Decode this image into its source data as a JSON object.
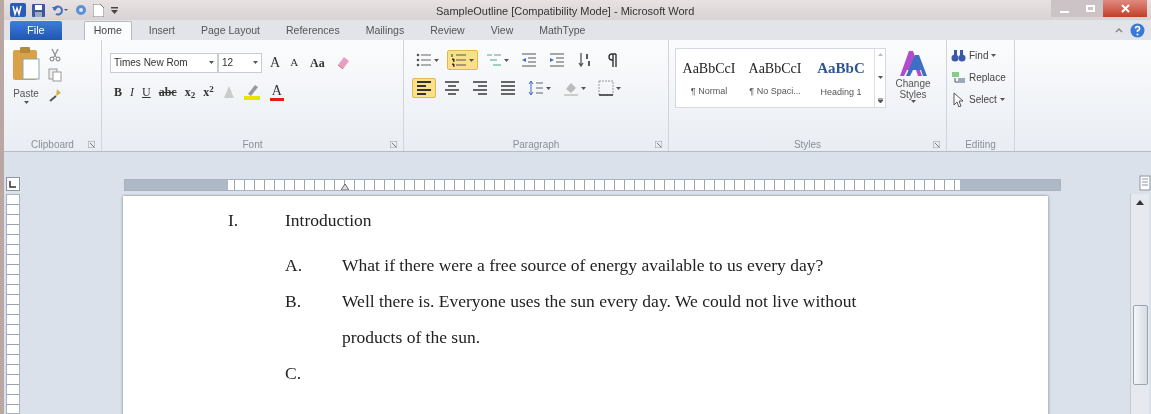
{
  "window": {
    "title": "SampleOutline [Compatibility Mode]  -  Microsoft Word"
  },
  "tabs": [
    {
      "label": "File",
      "kind": "file",
      "selected": false
    },
    {
      "label": "Home",
      "kind": "tab",
      "selected": true
    },
    {
      "label": "Insert",
      "kind": "tab",
      "selected": false
    },
    {
      "label": "Page Layout",
      "kind": "tab",
      "selected": false
    },
    {
      "label": "References",
      "kind": "tab",
      "selected": false
    },
    {
      "label": "Mailings",
      "kind": "tab",
      "selected": false
    },
    {
      "label": "Review",
      "kind": "tab",
      "selected": false
    },
    {
      "label": "View",
      "kind": "tab",
      "selected": false
    },
    {
      "label": "MathType",
      "kind": "tab",
      "selected": false
    }
  ],
  "clipboard": {
    "label": "Clipboard",
    "paste": "Paste"
  },
  "font": {
    "label": "Font",
    "font_name": "Times New Rom",
    "font_size": "12",
    "grow": "A",
    "shrink": "A",
    "change_case": "Aa",
    "format_buttons": [
      {
        "label": "B",
        "kind": "bold"
      },
      {
        "label": "I",
        "kind": "italic"
      },
      {
        "label": "U",
        "kind": "underline"
      },
      {
        "label": "abc",
        "kind": "strike"
      },
      {
        "label": "x$_{2}$",
        "kind": "plain"
      },
      {
        "label": "x$^{2}$",
        "kind": "plain"
      }
    ],
    "font_color": "A"
  },
  "paragraph": {
    "label": "Paragraph",
    "row_1": [
      {
        "kind": "bullets",
        "on": false
      },
      {
        "kind": "numbering",
        "on": true
      },
      {
        "kind": "multilevel",
        "on": false
      },
      {
        "kind": "outdent",
        "on": false
      },
      {
        "kind": "indent",
        "on": false
      },
      {
        "kind": "sort",
        "on": false
      },
      {
        "kind": "pilcrow",
        "on": false
      }
    ],
    "row_2": [
      {
        "kind": "align-left",
        "on": true
      },
      {
        "kind": "align-center",
        "on": false
      },
      {
        "kind": "align-right",
        "on": false
      },
      {
        "kind": "justify",
        "on": false
      },
      {
        "kind": "line-spacing",
        "on": false
      },
      {
        "kind": "shading",
        "on": false
      },
      {
        "kind": "borders",
        "on": false
      }
    ]
  },
  "styles": {
    "label": "Styles",
    "items": [
      {
        "preview": "AaBbCcI",
        "name": "¶ Normal",
        "kind": "body"
      },
      {
        "preview": "AaBbCcI",
        "name": "¶ No Spaci...",
        "kind": "body"
      },
      {
        "preview": "AaBbC",
        "name": "Heading 1",
        "kind": "heading"
      }
    ],
    "change_styles": "Change Styles"
  },
  "editing": {
    "label": "Editing",
    "items": [
      {
        "label": "Find",
        "kind": "find",
        "dropdown": true
      },
      {
        "label": "Replace",
        "kind": "replace",
        "dropdown": false
      },
      {
        "label": "Select",
        "kind": "select",
        "dropdown": true
      }
    ]
  },
  "document": {
    "outline": [
      {
        "marker": "I.",
        "text": "Introduction",
        "children": [
          {
            "marker": "A.",
            "text": "What if there were a free source of energy available to us every day?"
          },
          {
            "marker": "B.",
            "text": "Well there is. Everyone uses the sun every day. We could not live without products of the sun."
          },
          {
            "marker": "C."
          }
        ]
      }
    ]
  }
}
